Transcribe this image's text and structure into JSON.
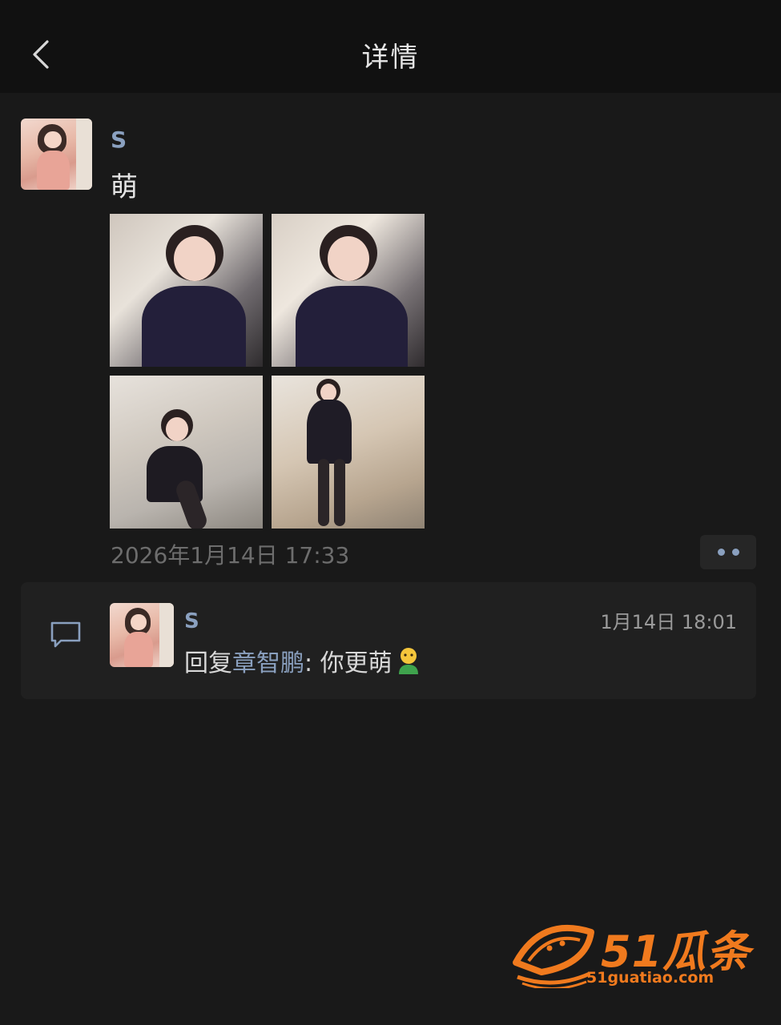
{
  "navbar": {
    "title": "详情",
    "back_icon": "chevron-left-icon"
  },
  "post": {
    "author": "S",
    "text": "萌",
    "photos": [
      "photo-1",
      "photo-2",
      "photo-3",
      "photo-4"
    ],
    "time": "2026年1月14日 17:33"
  },
  "comment": {
    "icon": "comment-icon",
    "author": "S",
    "time": "1月14日 18:01",
    "prefix": "回复",
    "mention": "章智鹏",
    "body": ": 你更萌"
  },
  "watermark": {
    "brand": "51瓜条",
    "url": "51guatiao.com"
  },
  "colors": {
    "accent": "#8aa0bf",
    "background": "#191919",
    "watermark": "#f07a1e"
  }
}
